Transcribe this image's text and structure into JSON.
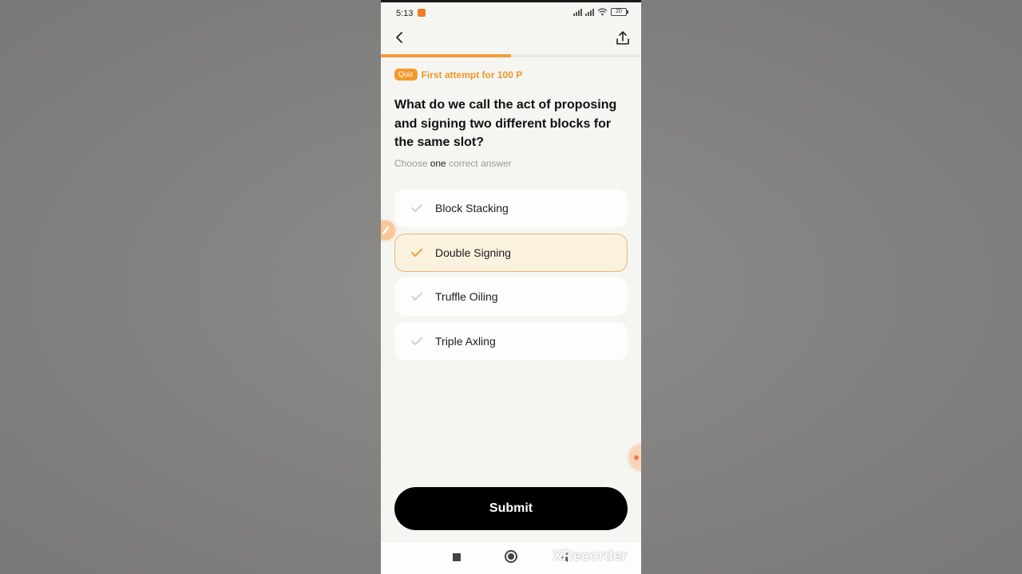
{
  "status_bar": {
    "time": "5:13",
    "battery": "20"
  },
  "header": {
    "back_icon": "chevron-left-icon",
    "share_icon": "share-icon"
  },
  "progress": {
    "fraction": 0.5
  },
  "quiz": {
    "badge": "Quiz",
    "reward": "First attempt for 100 P",
    "question": "What do we call the act of proposing and signing two different blocks for the same slot?",
    "instruction_prefix": "Choose ",
    "instruction_emphasis": "one",
    "instruction_suffix": " correct answer",
    "options": [
      {
        "label": "Block Stacking",
        "selected": false
      },
      {
        "label": "Double Signing",
        "selected": true
      },
      {
        "label": "Truffle Oiling",
        "selected": false
      },
      {
        "label": "Triple Axling",
        "selected": false
      }
    ],
    "submit_label": "Submit"
  },
  "nav": {
    "recent_icon": "square-icon",
    "home_icon": "circle-home-icon",
    "back_icon": "triangle-back-icon"
  },
  "watermark": "XRecorder",
  "colors": {
    "accent": "#f39c3a",
    "selected_bg": "#faf2df",
    "selected_border": "#f3b27a",
    "submit_bg": "#000000"
  }
}
